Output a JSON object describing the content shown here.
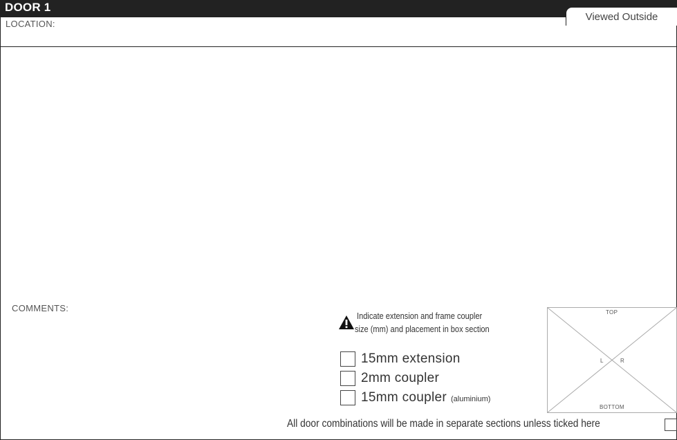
{
  "header": {
    "title": "DOOR 1",
    "view_tab": "Viewed Outside"
  },
  "location": {
    "label": "LOCATION:"
  },
  "comments": {
    "label": "COMMENTS:"
  },
  "notice": {
    "icon": "warning-triangle-icon",
    "line1": "Indicate extension and frame coupler",
    "line2": "size (mm) and placement in box section"
  },
  "options": [
    {
      "label": "15mm extension",
      "note": "",
      "checked": false
    },
    {
      "label": "2mm coupler",
      "note": "",
      "checked": false
    },
    {
      "label": "15mm coupler",
      "note": "(aluminium)",
      "checked": false
    }
  ],
  "diagram": {
    "top": "TOP",
    "bottom": "BOTTOM",
    "left": "L",
    "right": "R"
  },
  "footer": {
    "text": "All door combinations will be made in separate sections unless ticked here",
    "checked": false
  }
}
